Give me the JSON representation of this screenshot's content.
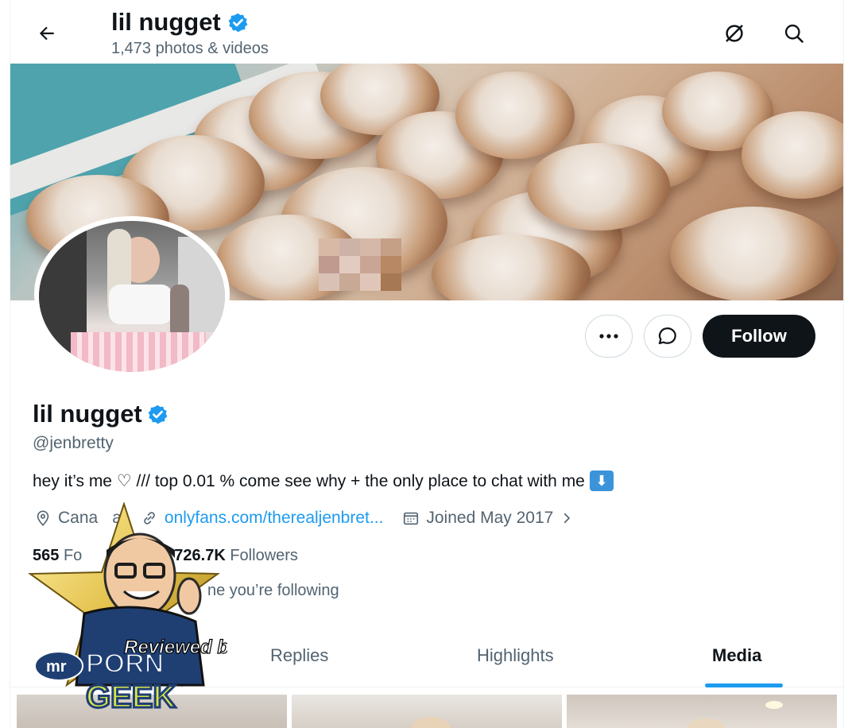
{
  "header": {
    "title": "lil nugget",
    "subtitle": "1,473 photos & videos"
  },
  "profile": {
    "display_name": "lil nugget",
    "handle": "@jenbretty",
    "bio_text": "hey it’s me ♡ /// top 0.01 % come see why + the only place to chat with me",
    "location": "Canada",
    "location_visible": "Cana",
    "location_tail": "a",
    "website": "onlyfans.com/therealjenbret...",
    "joined": "Joined May 2017",
    "following_count": "565",
    "following_label_visible": "Fo",
    "followers_count": "726.7K",
    "followers_label": "Followers",
    "followed_by_visible": "ne you’re following"
  },
  "actions": {
    "follow_label": "Follow"
  },
  "tabs": [
    {
      "label": "Replies"
    },
    {
      "label": "Highlights"
    },
    {
      "label": "Media",
      "active": true
    }
  ],
  "watermark": {
    "line1": "Reviewed by",
    "brand_mr": "mr",
    "brand_porn": "PORN",
    "brand_geek": "GEEK"
  },
  "colors": {
    "accent": "#1d9bf0",
    "follow_button": "#0f1419",
    "verified": "#1d9bf0",
    "secondary_text": "#536471"
  },
  "icons": [
    "back-arrow-icon",
    "verified-badge-icon",
    "hide-icon",
    "search-icon",
    "more-icon",
    "message-icon",
    "location-icon",
    "link-icon",
    "calendar-icon",
    "chevron-right-icon"
  ]
}
